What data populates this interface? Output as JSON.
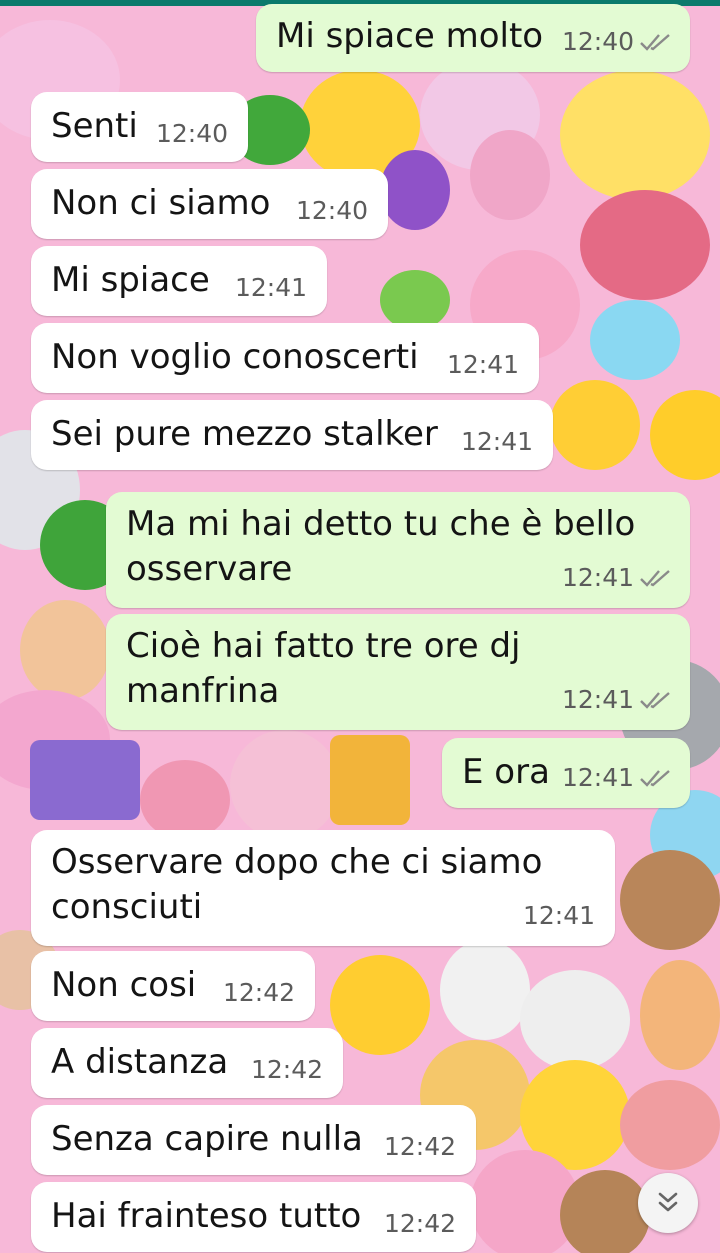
{
  "messages": [
    {
      "dir": "out",
      "text": "Mi spiace molto",
      "time": "12:40",
      "read": true
    },
    {
      "dir": "in",
      "text": "Senti",
      "time": "12:40"
    },
    {
      "dir": "in",
      "text": "Non ci siamo",
      "time": "12:40"
    },
    {
      "dir": "in",
      "text": "Mi spiace",
      "time": "12:41"
    },
    {
      "dir": "in",
      "text": "Non voglio conoscerti",
      "time": "12:41"
    },
    {
      "dir": "in",
      "text": "Sei pure mezzo stalker",
      "time": "12:41"
    },
    {
      "dir": "out",
      "lines": [
        "Ma mi hai detto tu che è bello",
        "osservare"
      ],
      "time": "12:41",
      "read": true
    },
    {
      "dir": "out",
      "lines": [
        "Cioè hai fatto tre ore dj",
        "manfrina"
      ],
      "time": "12:41",
      "read": true
    },
    {
      "dir": "out",
      "text": "E ora",
      "time": "12:41",
      "read": true
    },
    {
      "dir": "in",
      "lines": [
        "Osservare dopo che ci siamo",
        "consciuti"
      ],
      "time": "12:41"
    },
    {
      "dir": "in",
      "text": "Non cosi",
      "time": "12:42"
    },
    {
      "dir": "in",
      "text": "A distanza",
      "time": "12:42"
    },
    {
      "dir": "in",
      "text": "Senza capire nulla",
      "time": "12:42"
    },
    {
      "dir": "in",
      "text": "Hai frainteso tutto",
      "time": "12:42"
    }
  ],
  "icons": {
    "read_receipt": "double-check-icon",
    "scroll": "chevron-double-down-icon"
  },
  "colors": {
    "incoming": "#ffffff",
    "outgoing": "#e3fbd3",
    "header": "#0b7a6c",
    "tick": "#8a8a8a"
  }
}
